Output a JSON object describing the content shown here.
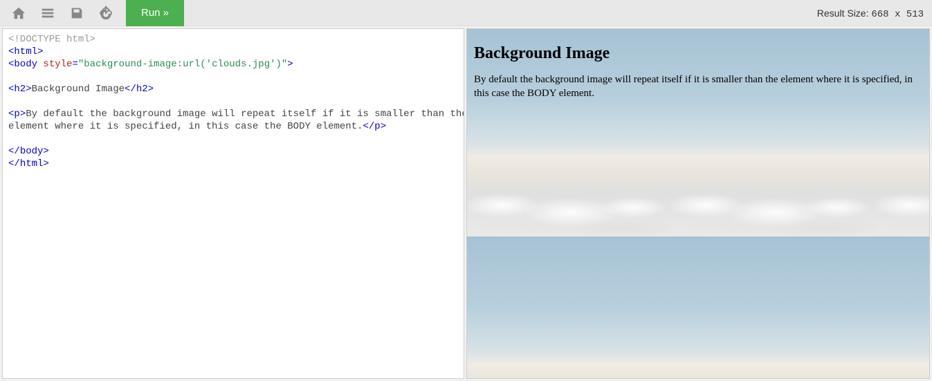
{
  "toolbar": {
    "run_label": "Run »"
  },
  "result": {
    "label": "Result Size:",
    "dims": "668 x 513"
  },
  "code": {
    "l1": "<!DOCTYPE html>",
    "l2o": "<",
    "l2t": "html",
    "l2c": ">",
    "l3o": "<",
    "l3t": "body",
    "l3a": " style",
    "l3e": "=",
    "l3v": "\"background-image:url('clouds.jpg')\"",
    "l3c": ">",
    "l4o": "<",
    "l4t": "h2",
    "l4c": ">",
    "l4x": "Background Image",
    "l4co": "</",
    "l4ct": "h2",
    "l4cc": ">",
    "l5o": "<",
    "l5t": "p",
    "l5c": ">",
    "l5x": "By default the background image will repeat itself if it is smaller than the\nelement where it is specified, in this case the BODY element.",
    "l5co": "</",
    "l5ct": "p",
    "l5cc": ">",
    "l6o": "</",
    "l6t": "body",
    "l6c": ">",
    "l7o": "</",
    "l7t": "html",
    "l7c": ">"
  },
  "preview": {
    "heading": "Background Image",
    "paragraph": "By default the background image will repeat itself if it is smaller than the element where it is specified, in this case the BODY element."
  }
}
